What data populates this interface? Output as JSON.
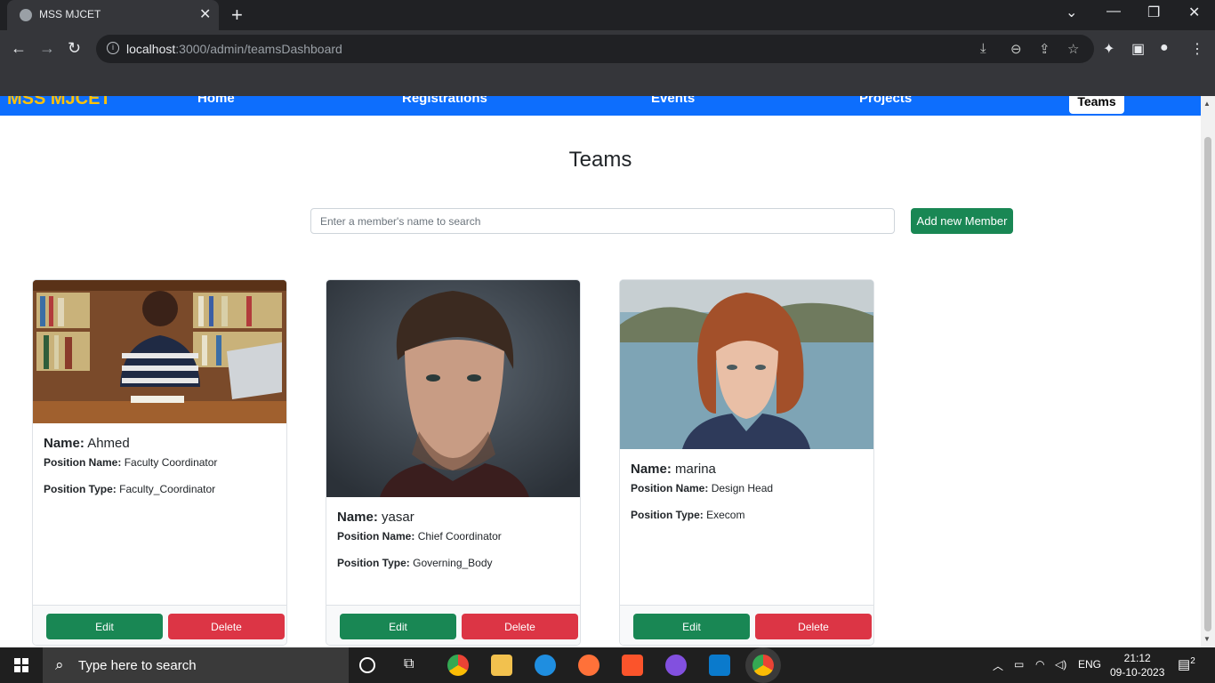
{
  "browser": {
    "tab_title": "MSS MJCET",
    "url_host": "localhost",
    "url_rest": ":3000/admin/teamsDashboard"
  },
  "site_nav": {
    "brand": "MSS MJCET",
    "links": [
      "Home",
      "Registrations",
      "Events",
      "Projects"
    ],
    "active": "Teams"
  },
  "page": {
    "title": "Teams",
    "search_placeholder": "Enter a member's name to search",
    "add_button": "Add new Member"
  },
  "labels": {
    "name": "Name:",
    "position_name": "Position Name:",
    "position_type": "Position Type:",
    "edit": "Edit",
    "delete": "Delete"
  },
  "members": [
    {
      "name": "Ahmed",
      "position_name": "Faculty Coordinator",
      "position_type": "Faculty_Coordinator"
    },
    {
      "name": "yasar",
      "position_name": "Chief Coordinator",
      "position_type": "Governing_Body"
    },
    {
      "name": "marina",
      "position_name": "Design Head",
      "position_type": "Execom"
    }
  ],
  "taskbar": {
    "search_placeholder": "Type here to search",
    "language": "ENG",
    "time": "21:12",
    "date": "09-10-2023",
    "notifications": "2"
  }
}
